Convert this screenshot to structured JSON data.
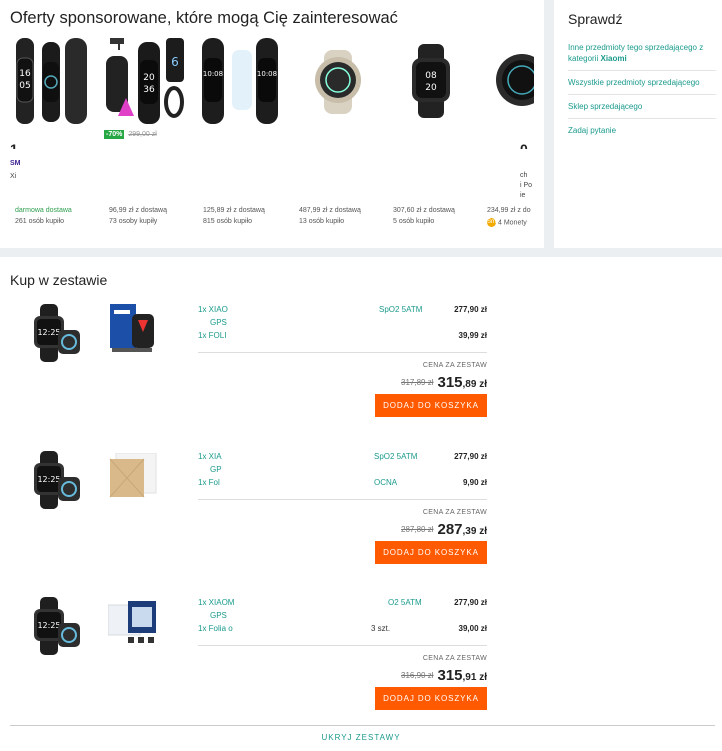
{
  "sponsored": {
    "title": "Oferty sponsorowane, które mogą Cię zainteresować",
    "tiles": [
      {
        "price": "1",
        "frag1": "SM",
        "frag2": "Xi",
        "ship": "darmowa dostawa",
        "free": true,
        "bought": "261 osób kupiło"
      },
      {
        "discount": "-70%",
        "old_price": "299,00 zł",
        "price": "",
        "ship": "96,99 zł z dostawą",
        "bought": "73 osoby kupiły"
      },
      {
        "price": "",
        "ship": "125,89 zł z dostawą",
        "bought": "815 osób kupiło"
      },
      {
        "price": "",
        "ship": "487,99 zł z dostawą",
        "bought": "13 osób kupiło"
      },
      {
        "price": "",
        "ship": "307,60 zł z dostawą",
        "bought": "5 osób kupiło"
      },
      {
        "price": "0",
        "frag1": "ch",
        "frag2": "i Po",
        "frag3": "ie",
        "ship": "234,99 zł z do",
        "monety": "4 Monety"
      }
    ]
  },
  "check": {
    "title": "Sprawdź",
    "link1_prefix": "Inne przedmioty tego sprzedającego z kategorii",
    "link1_bold": "Xiaomi",
    "link2": "Wszystkie przedmioty sprzedającego",
    "link3": "Sklep sprzedającego",
    "link4": "Zadaj pytanie"
  },
  "bundles": {
    "title": "Kup w zestawie",
    "cena_label": "CENA ZA ZESTAW",
    "add_label": "DODAJ DO KOSZYKA",
    "hide_label": "UKRYJ ZESTAWY",
    "items": [
      {
        "l1": "1x XIAO",
        "l1b": "SpO2 5ATM",
        "l1p": "277,90 zł",
        "gps": "GPS",
        "l2": "1x FOLI",
        "l2b": "",
        "l2p": "39,99 zł",
        "old": "317,89 zł",
        "big": "315",
        "small": ",89 zł"
      },
      {
        "l1": "1x XIA",
        "l1b": "SpO2 5ATM",
        "l1p": "277,90 zł",
        "gps": "GP",
        "l2": "1x Fol",
        "l2b": "OCNA",
        "l2p": "9,90 zł",
        "old": "287,80 zł",
        "big": "287",
        "small": ",39 zł"
      },
      {
        "l1": "1x XIAOM",
        "l1b": "O2 5ATM",
        "l1p": "277,90 zł",
        "gps": "GPS",
        "l2": "1x Folia o",
        "l2b": "3 szt.",
        "l2p": "39,00 zł",
        "old": "316,90 zł",
        "big": "315",
        "small": ",91 zł"
      }
    ]
  },
  "colors": {
    "accent": "#1a9a8c",
    "cta": "#ff5a00",
    "free": "#2e9f4f"
  }
}
